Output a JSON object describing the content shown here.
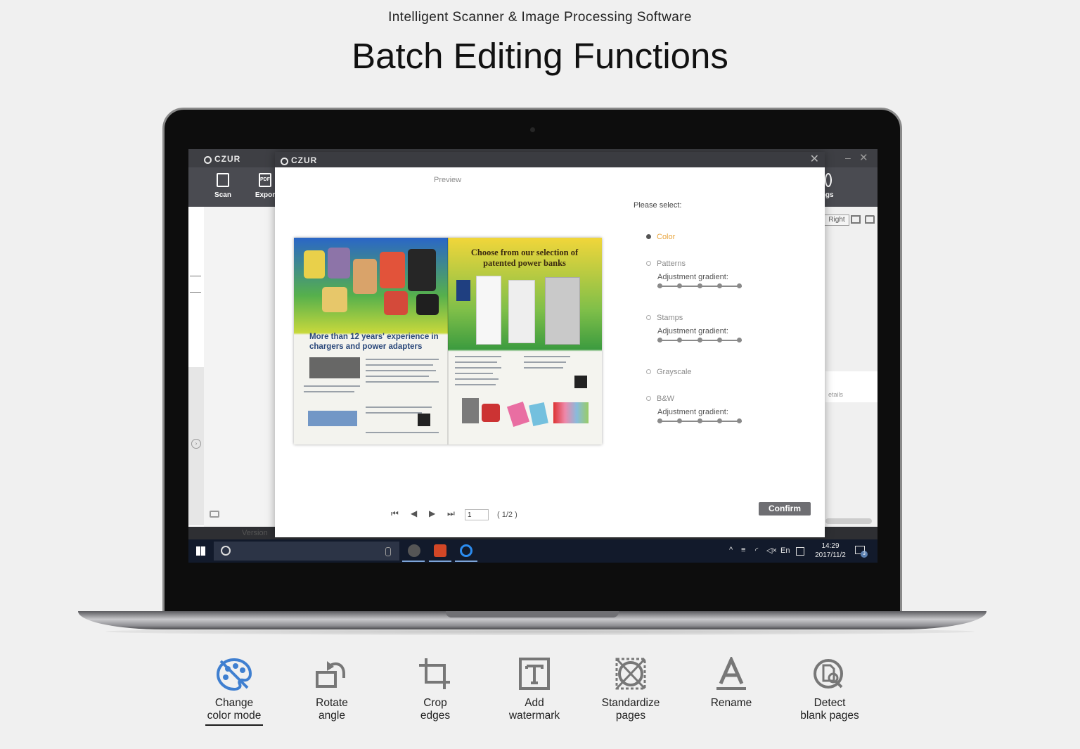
{
  "header": {
    "subtitle": "Intelligent Scanner & Image Processing Software",
    "title": "Batch Editing Functions"
  },
  "app": {
    "logo": "CZUR",
    "toolbar": [
      {
        "label": "Scan",
        "icon": "scan-icon"
      },
      {
        "label": "Expor",
        "icon": "pdf-export-icon",
        "icon_text": "PDF"
      },
      {
        "label": "ings",
        "icon": "settings-icon"
      }
    ],
    "right_button": "Right",
    "right_card_text": "etails",
    "version_label": "Version"
  },
  "dialog": {
    "logo": "CZUR",
    "preview_label": "Preview",
    "prompt": "Please select:",
    "options": [
      {
        "label": "Color",
        "selected": true
      },
      {
        "label": "Patterns",
        "selected": false,
        "slider_label": "Adjustment gradient:"
      },
      {
        "label": "Stamps",
        "selected": false,
        "slider_label": "Adjustment gradient:"
      },
      {
        "label": "Grayscale",
        "selected": false
      },
      {
        "label": "B&W",
        "selected": false,
        "slider_label": "Adjustment gradient:"
      }
    ],
    "slider_steps": 5,
    "confirm_label": "Confirm",
    "pager": {
      "current": "1",
      "count_text": "( 1/2 )"
    },
    "scan": {
      "headline_left": "More than 12 years' experience in chargers and power adapters",
      "headline_right": "Choose from our selection of patented power banks"
    }
  },
  "taskbar": {
    "language": "En",
    "time": "14:29",
    "date": "2017/11/2",
    "notification_count": "3"
  },
  "features": [
    {
      "label_line1": "Change",
      "label_line2": "color mode",
      "icon": "palette-icon",
      "active": true,
      "color": "#3f7fd0"
    },
    {
      "label_line1": "Rotate",
      "label_line2": "angle",
      "icon": "rotate-icon",
      "active": false
    },
    {
      "label_line1": "Crop",
      "label_line2": "edges",
      "icon": "crop-icon",
      "active": false
    },
    {
      "label_line1": "Add",
      "label_line2": "watermark",
      "icon": "watermark-icon",
      "active": false
    },
    {
      "label_line1": "Standardize",
      "label_line2": "pages",
      "icon": "standardize-icon",
      "active": false
    },
    {
      "label_line1": "Rename",
      "label_line2": "",
      "icon": "rename-icon",
      "active": false
    },
    {
      "label_line1": "Detect",
      "label_line2": "blank pages",
      "icon": "detect-blank-icon",
      "active": false
    }
  ]
}
